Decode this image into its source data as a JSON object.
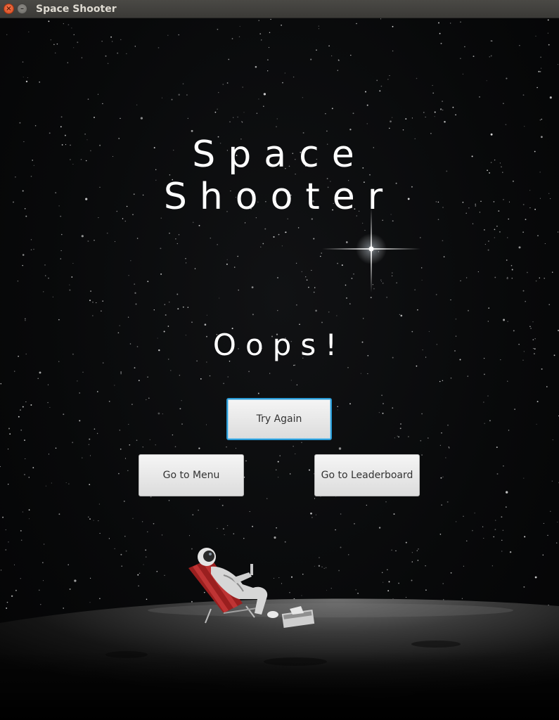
{
  "window": {
    "title": "Space Shooter",
    "close_glyph": "×",
    "minimize_glyph": "–"
  },
  "game": {
    "title_line1": "Space",
    "title_line2": "Shooter",
    "message": "Oops!"
  },
  "buttons": {
    "try_again": "Try Again",
    "menu": "Go to Menu",
    "leaderboard": "Go to Leaderboard"
  },
  "colors": {
    "focus_ring": "#2a9bd6",
    "close_button": "#e05a2b"
  },
  "icons": {
    "close": "close-icon",
    "minimize": "minimize-icon"
  }
}
